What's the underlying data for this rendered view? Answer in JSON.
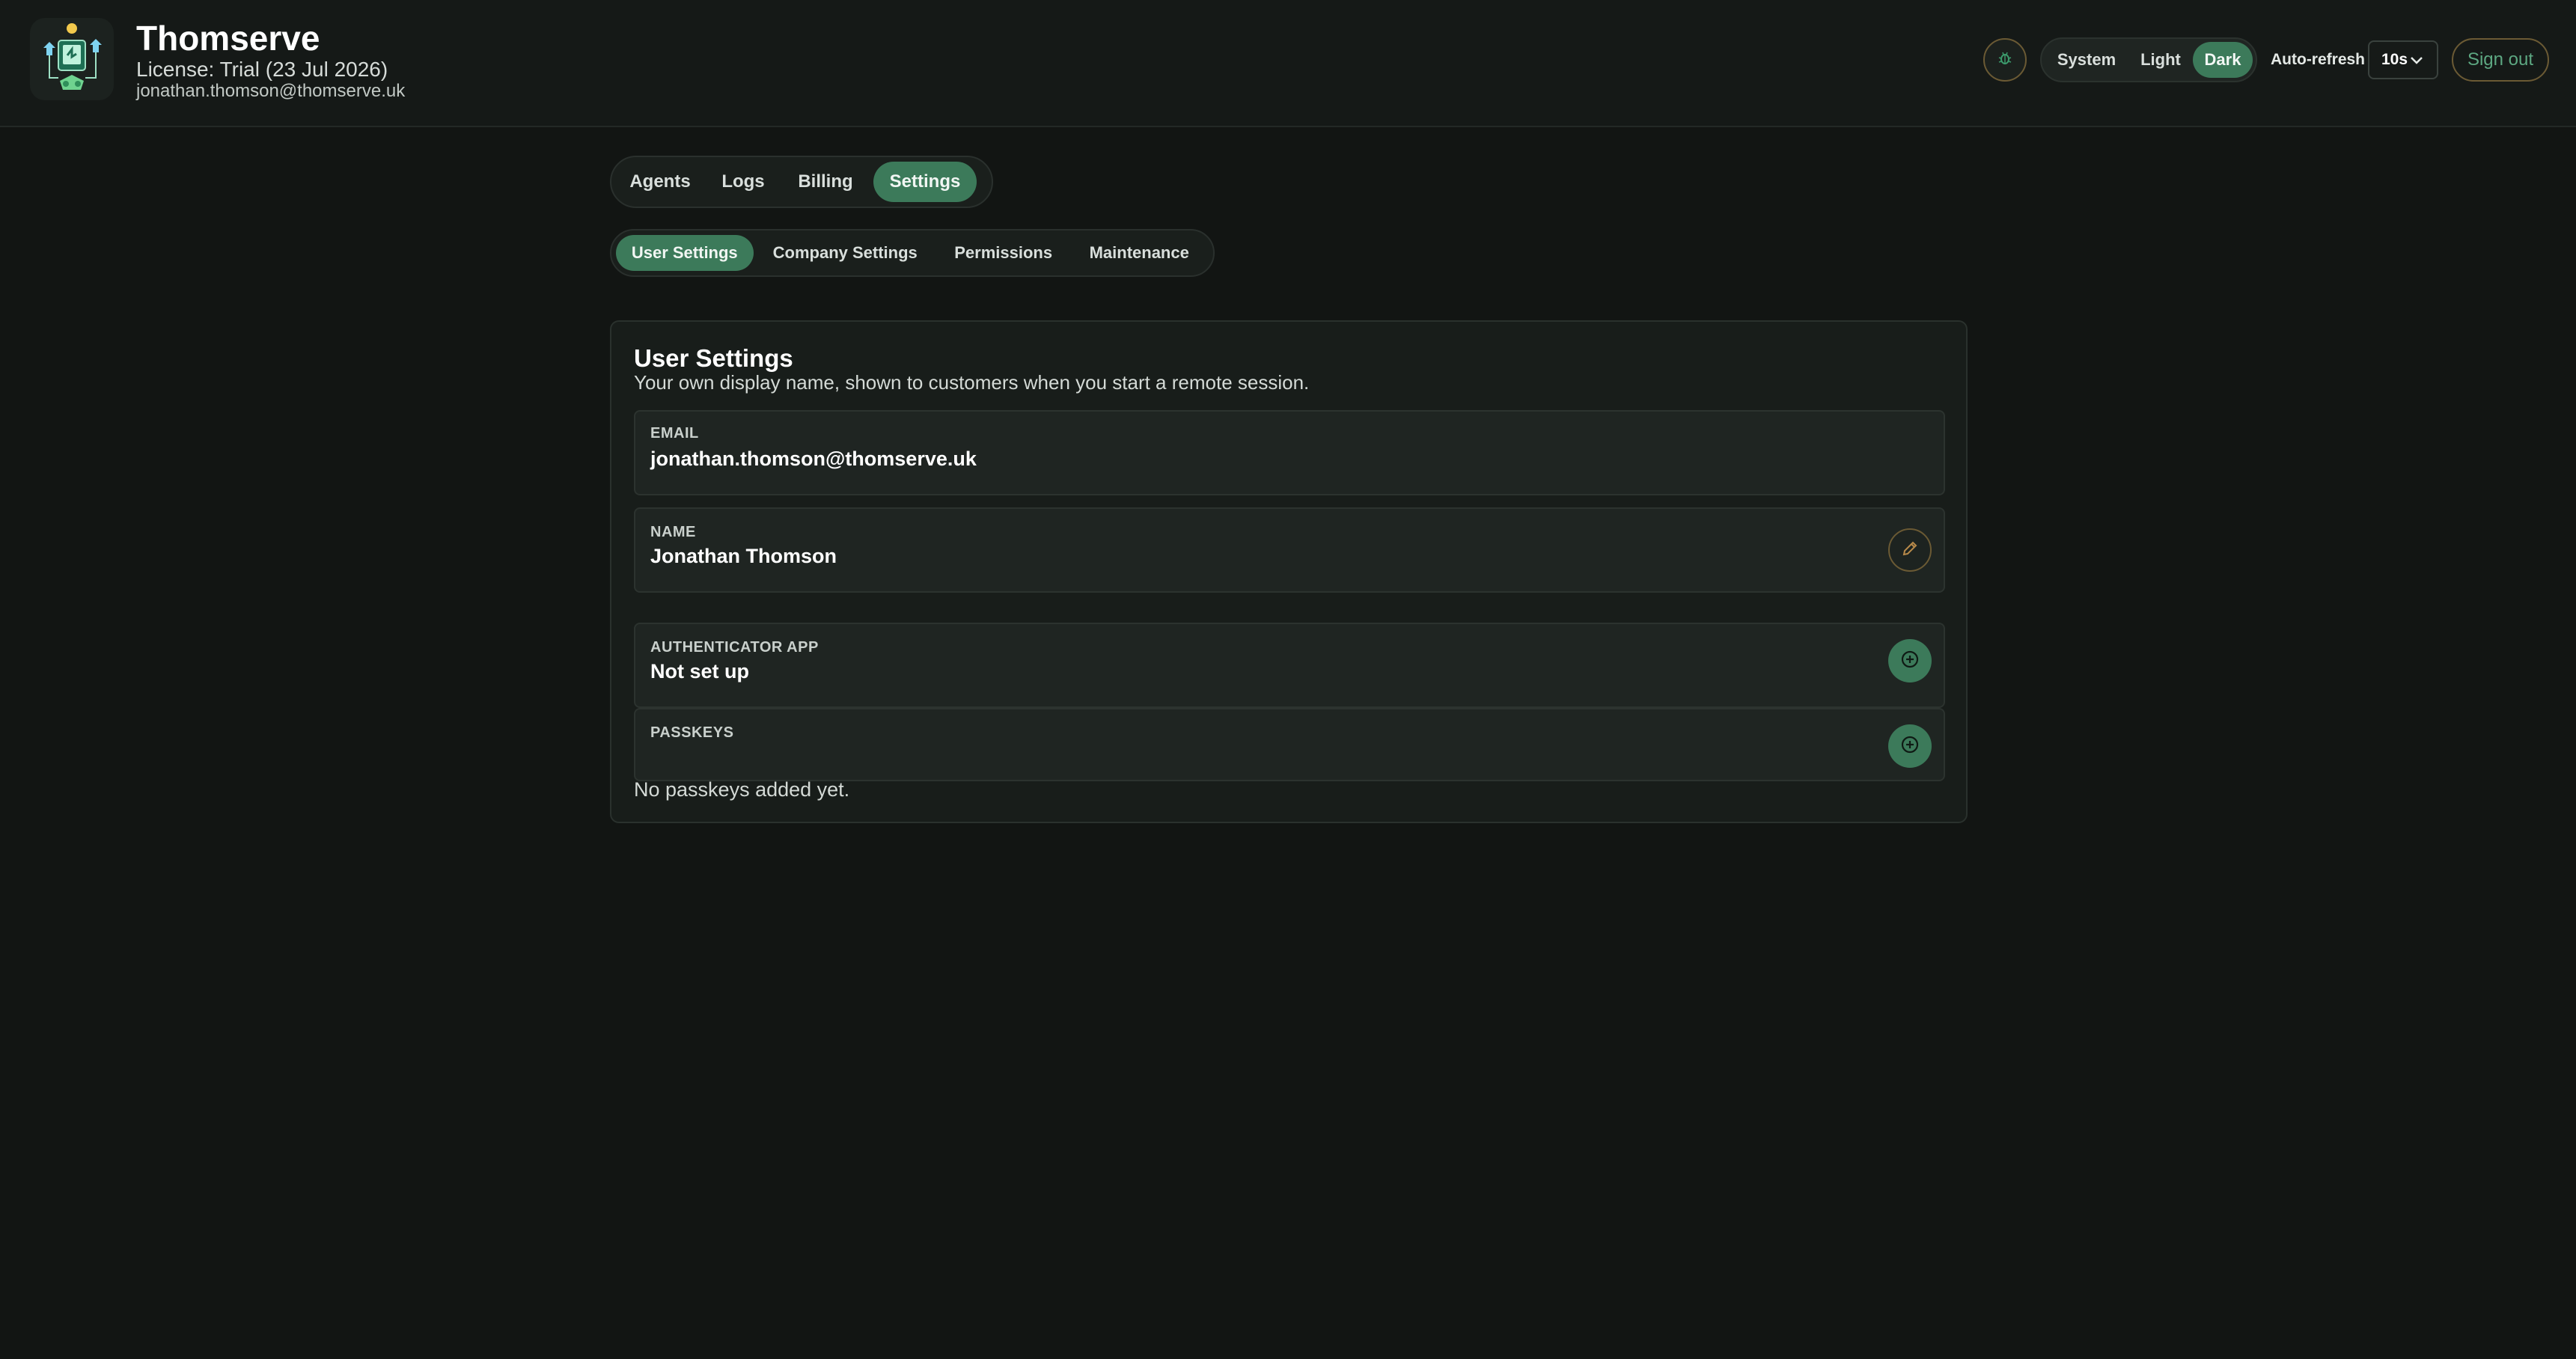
{
  "header": {
    "app_name": "Thomserve",
    "license": "License: Trial (23 Jul 2026)",
    "email": "jonathan.thomson@thomserve.uk",
    "theme_options": [
      "System",
      "Light",
      "Dark"
    ],
    "active_theme": "Dark",
    "auto_refresh_label": "Auto-refresh",
    "auto_refresh_value": "10s",
    "sign_out_label": "Sign out"
  },
  "nav": {
    "main_tabs": [
      "Agents",
      "Logs",
      "Billing",
      "Settings"
    ],
    "active_main": "Settings",
    "sub_tabs": [
      "User Settings",
      "Company Settings",
      "Permissions",
      "Maintenance"
    ],
    "active_sub": "User Settings"
  },
  "user_settings": {
    "title": "User Settings",
    "description": "Your own display name, shown to customers when you start a remote session.",
    "email_label": "EMAIL",
    "email_value": "jonathan.thomson@thomserve.uk",
    "name_label": "NAME",
    "name_value": "Jonathan Thomson",
    "auth_label": "AUTHENTICATOR APP",
    "auth_value": "Not set up",
    "passkeys_label": "PASSKEYS",
    "passkeys_empty": "No passkeys added yet."
  },
  "colors": {
    "background": "#121513",
    "accent_green": "#3c7a5a",
    "accent_gold": "#6b5a34",
    "sign_out_text": "#5da882"
  },
  "icons": {
    "logo": "computer-support-logo",
    "bug": "bug-icon",
    "select": "chevron-down-icon",
    "edit": "pencil-icon",
    "add": "plus-circle-icon"
  }
}
